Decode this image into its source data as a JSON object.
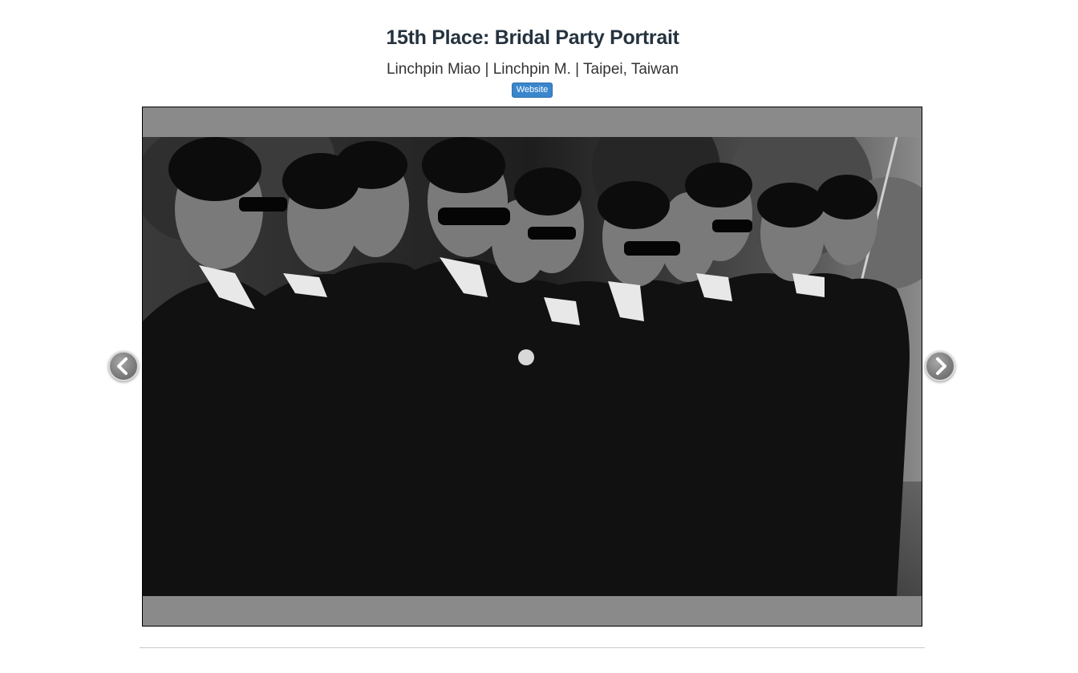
{
  "header": {
    "title": "15th Place: Bridal Party Portrait",
    "subtitle": "Linchpin Miao | Linchpin M. | Taipei, Taiwan",
    "website_label": "Website"
  },
  "slideshow": {
    "photo_description": "Black-and-white photo of a groom and groomsmen in dark suits and sunglasses standing in a row, looking to the right",
    "prev_icon": "chevron-left-icon",
    "next_icon": "chevron-right-icon"
  },
  "colors": {
    "title": "#25333f",
    "button": "#3a86cc",
    "letterbox": "#8a8a8a"
  }
}
